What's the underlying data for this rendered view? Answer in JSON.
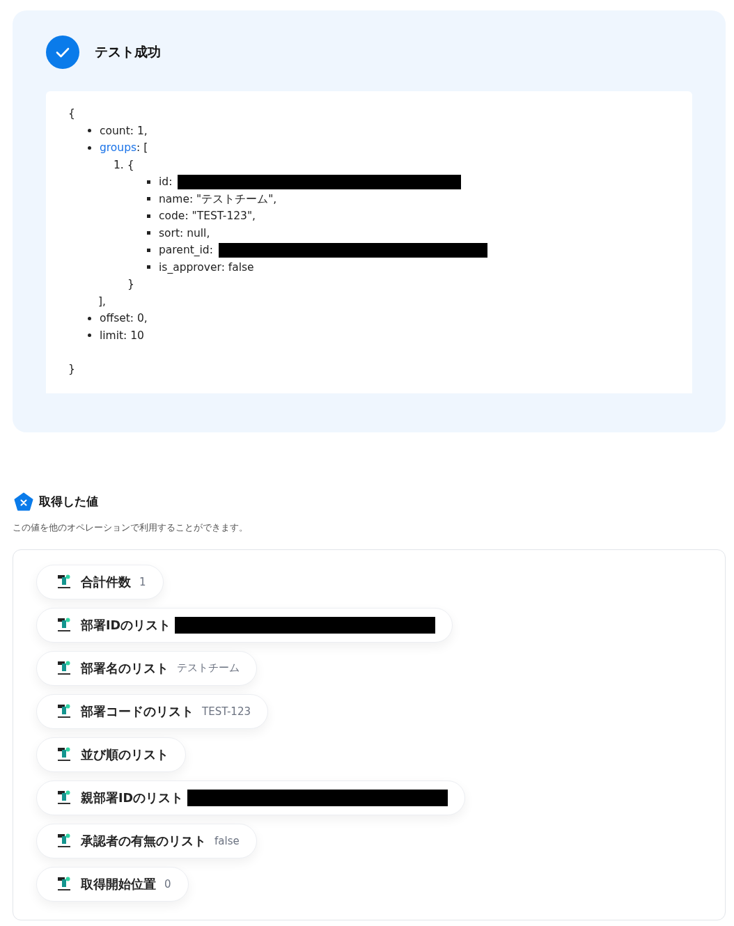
{
  "test_result": {
    "title": "テスト成功",
    "response": {
      "open": "{",
      "close": "}",
      "items": [
        {
          "kind": "line",
          "text": "count: 1,"
        },
        {
          "kind": "array",
          "key": "groups",
          "after": ": [",
          "close": "],",
          "entries": [
            {
              "marker": "1.",
              "open": "{",
              "close": "}",
              "fields": [
                {
                  "text": "id:",
                  "redacted": true
                },
                {
                  "text": "name: \"テストチーム\",",
                  "redacted": false
                },
                {
                  "text": "code: \"TEST-123\",",
                  "redacted": false
                },
                {
                  "text": "sort: null,",
                  "redacted": false
                },
                {
                  "text": "parent_id:",
                  "redacted": true
                },
                {
                  "text": "is_approver: false",
                  "redacted": false
                }
              ]
            }
          ]
        },
        {
          "kind": "line",
          "text": "offset: 0,"
        },
        {
          "kind": "line",
          "text": "limit: 10"
        }
      ]
    }
  },
  "retrieved_values": {
    "title": "取得した値",
    "description": "この値を他のオペレーションで利用することができます。",
    "values": [
      {
        "label": "合計件数",
        "value": "1",
        "redacted": false
      },
      {
        "label": "部署IDのリスト",
        "redacted": true
      },
      {
        "label": "部署名のリスト",
        "value": "テストチーム",
        "redacted": false
      },
      {
        "label": "部署コードのリスト",
        "value": "TEST-123",
        "redacted": false
      },
      {
        "label": "並び順のリスト",
        "redacted": false
      },
      {
        "label": "親部署IDのリスト",
        "redacted": true
      },
      {
        "label": "承認者の有無のリスト",
        "value": "false",
        "redacted": false
      },
      {
        "label": "取得開始位置",
        "value": "0",
        "redacted": false
      }
    ]
  }
}
